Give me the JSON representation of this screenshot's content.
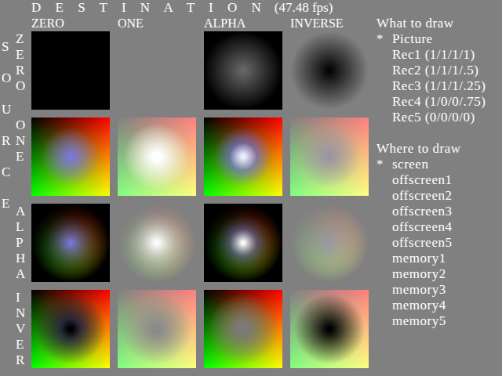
{
  "title": "D E S T I N A T I O N",
  "fps": "(47.48 fps)",
  "source_label": "SOURCE",
  "columns": [
    "ZERO",
    "ONE",
    "ALPHA",
    "INVERSE"
  ],
  "rows": [
    {
      "label": "ZERO",
      "cells": [
        {
          "kind": "black"
        },
        {
          "kind": "empty"
        },
        {
          "kind": "glow-gray"
        },
        {
          "kind": "hole-gray"
        }
      ]
    },
    {
      "label": "ONE",
      "cells": [
        {
          "kind": "colors-blue"
        },
        {
          "kind": "pastel-white"
        },
        {
          "kind": "colors-white"
        },
        {
          "kind": "pastel-hole"
        }
      ]
    },
    {
      "label": "ALPHA",
      "cells": [
        {
          "kind": "glow-colors"
        },
        {
          "kind": "gray-glow"
        },
        {
          "kind": "glow-white"
        },
        {
          "kind": "gray-glow-colors"
        }
      ]
    },
    {
      "label": "INVER",
      "cells": [
        {
          "kind": "colors-hole"
        },
        {
          "kind": "pastel-gray"
        },
        {
          "kind": "colors-gray"
        },
        {
          "kind": "pastel-black"
        }
      ]
    }
  ],
  "menus": [
    {
      "heading": "What to draw",
      "marker": "*",
      "items": [
        {
          "label": "Picture",
          "selected": true
        },
        {
          "label": "Rec1 (1/1/1/1)",
          "selected": false
        },
        {
          "label": "Rec2 (1/1/1/.5)",
          "selected": false
        },
        {
          "label": "Rec3 (1/1/1/.25)",
          "selected": false
        },
        {
          "label": "Rec4 (1/0/0/.75)",
          "selected": false
        },
        {
          "label": "Rec5 (0/0/0/0)",
          "selected": false
        }
      ]
    },
    {
      "heading": "Where to draw",
      "marker": "*",
      "items": [
        {
          "label": "screen",
          "selected": true
        },
        {
          "label": "offscreen1",
          "selected": false
        },
        {
          "label": "offscreen2",
          "selected": false
        },
        {
          "label": "offscreen3",
          "selected": false
        },
        {
          "label": "offscreen4",
          "selected": false
        },
        {
          "label": "offscreen5",
          "selected": false
        },
        {
          "label": "memory1",
          "selected": false
        },
        {
          "label": "memory2",
          "selected": false
        },
        {
          "label": "memory3",
          "selected": false
        },
        {
          "label": "memory4",
          "selected": false
        },
        {
          "label": "memory5",
          "selected": false
        }
      ]
    }
  ]
}
